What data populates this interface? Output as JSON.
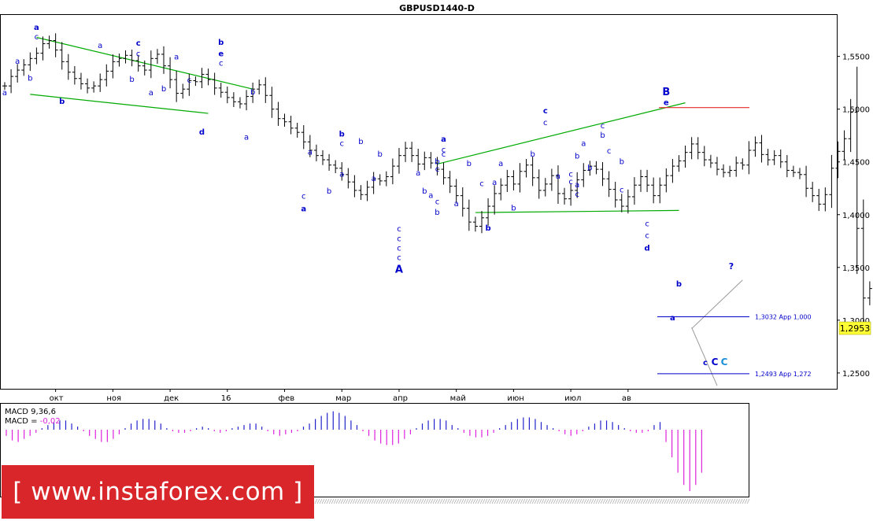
{
  "title": "GBPUSD1440-D",
  "price_badge": "1,2953",
  "indicator": {
    "label1": "MACD 9,36,6",
    "label2_prefix": "MACD = ",
    "label2_value": "-0,02",
    "values": [
      -0.004,
      -0.007,
      -0.008,
      -0.006,
      -0.004,
      -0.002,
      0.001,
      0.003,
      0.005,
      0.006,
      0.006,
      0.004,
      0.002,
      -0.001,
      -0.004,
      -0.006,
      -0.008,
      -0.008,
      -0.006,
      -0.003,
      0.001,
      0.004,
      0.006,
      0.007,
      0.007,
      0.006,
      0.004,
      0.001,
      -0.001,
      -0.002,
      -0.002,
      -0.001,
      0.001,
      0.002,
      0.001,
      -0.001,
      -0.002,
      -0.001,
      0.001,
      0.002,
      0.003,
      0.004,
      0.004,
      0.002,
      -0.001,
      -0.003,
      -0.004,
      -0.003,
      -0.002,
      -0.001,
      0.002,
      0.004,
      0.007,
      0.009,
      0.011,
      0.012,
      0.011,
      0.009,
      0.006,
      0.003,
      -0.001,
      -0.004,
      -0.007,
      -0.009,
      -0.01,
      -0.01,
      -0.009,
      -0.006,
      -0.003,
      0.001,
      0.004,
      0.006,
      0.007,
      0.007,
      0.006,
      0.003,
      0.001,
      -0.002,
      -0.004,
      -0.005,
      -0.005,
      -0.004,
      -0.002,
      0.001,
      0.003,
      0.005,
      0.007,
      0.008,
      0.008,
      0.007,
      0.005,
      0.003,
      0.001,
      -0.001,
      -0.003,
      -0.004,
      -0.003,
      -0.001,
      0.002,
      0.004,
      0.006,
      0.006,
      0.005,
      0.003,
      0.001,
      -0.001,
      -0.002,
      -0.002,
      -0.001,
      0.003,
      0.005,
      -0.008,
      -0.018,
      -0.028,
      -0.036,
      -0.04,
      -0.036,
      -0.028
    ]
  },
  "watermark": {
    "open": "[",
    "text": "www.instaforex.com",
    "close": "]",
    "bg": "#d8262a"
  },
  "colors": {
    "candles": "#000000",
    "channel": "#00aa00",
    "resistance": "#e32b2b",
    "target": "#0000cc",
    "wave_label": "#0000cc",
    "wave_label_alt": "#1b8fd8",
    "macd_pos": "#2222cc",
    "macd_neg": "#dd22dd",
    "forecast": "#999999"
  },
  "chart_data": {
    "type": "candlestick",
    "title": "GBPUSD1440-D",
    "ylim": [
      1.235,
      1.59
    ],
    "y_ticks": [
      "1,2500",
      "1,3000",
      "1,3500",
      "1,4000",
      "1,4500",
      "1,5000",
      "1,5500"
    ],
    "y_tick_values": [
      1.25,
      1.3,
      1.35,
      1.4,
      1.45,
      1.5,
      1.55
    ],
    "x_ticks": [
      "окт",
      "ноя",
      "дек",
      "16",
      "фев",
      "мар",
      "апр",
      "май",
      "июн",
      "июл",
      "ав"
    ],
    "x_tick_index": [
      8,
      17,
      26,
      35,
      44,
      53,
      62,
      71,
      80,
      89,
      98
    ],
    "close": [
      1.522,
      1.531,
      1.537,
      1.542,
      1.548,
      1.553,
      1.562,
      1.565,
      1.556,
      1.545,
      1.535,
      1.529,
      1.524,
      1.52,
      1.522,
      1.528,
      1.536,
      1.545,
      1.548,
      1.551,
      1.546,
      1.541,
      1.537,
      1.548,
      1.552,
      1.541,
      1.528,
      1.515,
      1.519,
      1.527,
      1.526,
      1.533,
      1.528,
      1.52,
      1.516,
      1.511,
      1.507,
      1.505,
      1.512,
      1.519,
      1.523,
      1.513,
      1.5,
      1.491,
      1.488,
      1.482,
      1.478,
      1.469,
      1.461,
      1.456,
      1.452,
      1.447,
      1.444,
      1.438,
      1.431,
      1.423,
      1.419,
      1.426,
      1.434,
      1.432,
      1.436,
      1.446,
      1.456,
      1.463,
      1.456,
      1.448,
      1.454,
      1.449,
      1.443,
      1.435,
      1.427,
      1.418,
      1.406,
      1.393,
      1.389,
      1.397,
      1.408,
      1.42,
      1.428,
      1.436,
      1.429,
      1.441,
      1.447,
      1.435,
      1.423,
      1.429,
      1.437,
      1.42,
      1.415,
      1.423,
      1.433,
      1.442,
      1.446,
      1.443,
      1.434,
      1.424,
      1.414,
      1.408,
      1.417,
      1.428,
      1.436,
      1.428,
      1.418,
      1.428,
      1.437,
      1.446,
      1.451,
      1.459,
      1.467,
      1.459,
      1.452,
      1.449,
      1.443,
      1.44,
      1.442,
      1.449,
      1.447,
      1.461,
      1.468,
      1.457,
      1.452,
      1.456,
      1.45,
      1.442,
      1.44,
      1.438,
      1.425,
      1.418,
      1.41,
      1.419,
      1.444,
      1.46,
      1.472,
      1.497,
      1.387,
      1.321,
      1.33,
      1.342,
      1.335,
      1.325,
      1.298,
      1.293,
      1.295
    ],
    "annotations_text": [
      "a",
      "b",
      "c",
      "d",
      "e",
      "A",
      "B",
      "C",
      "c C C",
      "?"
    ],
    "levels": [
      {
        "label": "1,3032 Арр 1,000",
        "value": 1.3032
      },
      {
        "label": "1,2493 Арр 1,272",
        "value": 1.2493
      },
      {
        "label": "",
        "value": 1.5015
      }
    ],
    "wave_labels": [
      {
        "t": "a",
        "i": 0,
        "p": 1.513,
        "bold": false
      },
      {
        "t": "a",
        "i": 5,
        "p": 1.575,
        "bold": true
      },
      {
        "t": "c",
        "i": 5,
        "p": 1.566,
        "bold": false
      },
      {
        "t": "a",
        "i": 2,
        "p": 1.543,
        "bold": false
      },
      {
        "t": "b",
        "i": 4,
        "p": 1.527,
        "bold": false
      },
      {
        "t": "b",
        "i": 9,
        "p": 1.505,
        "bold": true
      },
      {
        "t": "a",
        "i": 15,
        "p": 1.558,
        "bold": false
      },
      {
        "t": "b",
        "i": 20,
        "p": 1.526,
        "bold": false
      },
      {
        "t": "c",
        "i": 21,
        "p": 1.56,
        "bold": true
      },
      {
        "t": "c",
        "i": 21,
        "p": 1.55,
        "bold": false
      },
      {
        "t": "a",
        "i": 23,
        "p": 1.513,
        "bold": false
      },
      {
        "t": "a",
        "i": 27,
        "p": 1.547,
        "bold": false
      },
      {
        "t": "b",
        "i": 25,
        "p": 1.517,
        "bold": false
      },
      {
        "t": "c",
        "i": 29,
        "p": 1.525,
        "bold": false
      },
      {
        "t": "b",
        "i": 34,
        "p": 1.561,
        "bold": true
      },
      {
        "t": "e",
        "i": 34,
        "p": 1.55,
        "bold": true
      },
      {
        "t": "c",
        "i": 34,
        "p": 1.541,
        "bold": false
      },
      {
        "t": "b",
        "i": 39,
        "p": 1.514,
        "bold": false
      },
      {
        "t": "d",
        "i": 31,
        "p": 1.476,
        "bold": true
      },
      {
        "t": "a",
        "i": 38,
        "p": 1.471,
        "bold": false
      },
      {
        "t": "c",
        "i": 47,
        "p": 1.415,
        "bold": false
      },
      {
        "t": "a",
        "i": 47,
        "p": 1.403,
        "bold": true
      },
      {
        "t": "b",
        "i": 51,
        "p": 1.42,
        "bold": false
      },
      {
        "t": "a",
        "i": 48,
        "p": 1.457,
        "bold": false
      },
      {
        "t": "a",
        "i": 53,
        "p": 1.436,
        "bold": false
      },
      {
        "t": "b",
        "i": 53,
        "p": 1.474,
        "bold": true
      },
      {
        "t": "c",
        "i": 53,
        "p": 1.465,
        "bold": false
      },
      {
        "t": "b",
        "i": 56,
        "p": 1.467,
        "bold": false
      },
      {
        "t": "b",
        "i": 59,
        "p": 1.455,
        "bold": false
      },
      {
        "t": "a",
        "i": 58,
        "p": 1.432,
        "bold": false
      },
      {
        "t": "c",
        "i": 62,
        "p": 1.384,
        "bold": false
      },
      {
        "t": "c",
        "i": 62,
        "p": 1.375,
        "bold": false
      },
      {
        "t": "c",
        "i": 62,
        "p": 1.366,
        "bold": false
      },
      {
        "t": "c",
        "i": 62,
        "p": 1.357,
        "bold": false
      },
      {
        "t": "A",
        "i": 62,
        "p": 1.345,
        "bold": true
      },
      {
        "t": "a",
        "i": 65,
        "p": 1.437,
        "bold": false
      },
      {
        "t": "c",
        "i": 68,
        "p": 1.441,
        "bold": false
      },
      {
        "t": "b",
        "i": 66,
        "p": 1.42,
        "bold": false
      },
      {
        "t": "c",
        "i": 69,
        "p": 1.455,
        "bold": false
      },
      {
        "t": "a",
        "i": 69,
        "p": 1.469,
        "bold": true
      },
      {
        "t": "c",
        "i": 69,
        "p": 1.459,
        "bold": false
      },
      {
        "t": "b",
        "i": 68,
        "p": 1.448,
        "bold": false
      },
      {
        "t": "a",
        "i": 67,
        "p": 1.416,
        "bold": false
      },
      {
        "t": "c",
        "i": 68,
        "p": 1.41,
        "bold": false
      },
      {
        "t": "b",
        "i": 68,
        "p": 1.4,
        "bold": false
      },
      {
        "t": "b",
        "i": 73,
        "p": 1.446,
        "bold": false
      },
      {
        "t": "a",
        "i": 71,
        "p": 1.408,
        "bold": false
      },
      {
        "t": "c",
        "i": 75,
        "p": 1.427,
        "bold": false
      },
      {
        "t": "b",
        "i": 80,
        "p": 1.404,
        "bold": false
      },
      {
        "t": "b",
        "i": 76,
        "p": 1.385,
        "bold": true
      },
      {
        "t": "a",
        "i": 78,
        "p": 1.446,
        "bold": false
      },
      {
        "t": "a",
        "i": 77,
        "p": 1.428,
        "bold": false
      },
      {
        "t": "c",
        "i": 85,
        "p": 1.496,
        "bold": true
      },
      {
        "t": "c",
        "i": 85,
        "p": 1.485,
        "bold": false
      },
      {
        "t": "b",
        "i": 83,
        "p": 1.455,
        "bold": false
      },
      {
        "t": "a",
        "i": 87,
        "p": 1.434,
        "bold": false
      },
      {
        "t": "c",
        "i": 89,
        "p": 1.436,
        "bold": false
      },
      {
        "t": "b",
        "i": 90,
        "p": 1.453,
        "bold": false
      },
      {
        "t": "a",
        "i": 90,
        "p": 1.426,
        "bold": false
      },
      {
        "t": "c",
        "i": 89,
        "p": 1.429,
        "bold": false
      },
      {
        "t": "c",
        "i": 90,
        "p": 1.417,
        "bold": false
      },
      {
        "t": "a",
        "i": 91,
        "p": 1.465,
        "bold": false
      },
      {
        "t": "b",
        "i": 92,
        "p": 1.442,
        "bold": false
      },
      {
        "t": "c",
        "i": 94,
        "p": 1.482,
        "bold": false
      },
      {
        "t": "b",
        "i": 94,
        "p": 1.473,
        "bold": false
      },
      {
        "t": "c",
        "i": 95,
        "p": 1.458,
        "bold": false
      },
      {
        "t": "b",
        "i": 97,
        "p": 1.448,
        "bold": false
      },
      {
        "t": "c",
        "i": 97,
        "p": 1.421,
        "bold": false
      },
      {
        "t": "c",
        "i": 101,
        "p": 1.389,
        "bold": false
      },
      {
        "t": "c",
        "i": 101,
        "p": 1.378,
        "bold": false
      },
      {
        "t": "d",
        "i": 101,
        "p": 1.366,
        "bold": true
      },
      {
        "t": "B",
        "i": 104,
        "p": 1.513,
        "bold": true
      },
      {
        "t": "e",
        "i": 104,
        "p": 1.504,
        "bold": true
      },
      {
        "t": "b",
        "i": 106,
        "p": 1.332,
        "bold": true
      },
      {
        "t": "a",
        "i": 105,
        "p": 1.3,
        "bold": true
      }
    ],
    "channels": [
      {
        "from": [
          5,
          1.568
        ],
        "to": [
          39,
          1.519
        ]
      },
      {
        "from": [
          4,
          1.514
        ],
        "to": [
          32,
          1.496
        ]
      },
      {
        "from": [
          68,
          1.448
        ],
        "to": [
          107,
          1.506
        ]
      },
      {
        "from": [
          74,
          1.402
        ],
        "to": [
          106,
          1.404
        ]
      }
    ],
    "forecast_line": [
      [
        108,
        1.292
      ],
      [
        116,
        1.338
      ]
    ],
    "forecast_down": [
      [
        108,
        1.293
      ],
      [
        112,
        1.238
      ]
    ]
  }
}
